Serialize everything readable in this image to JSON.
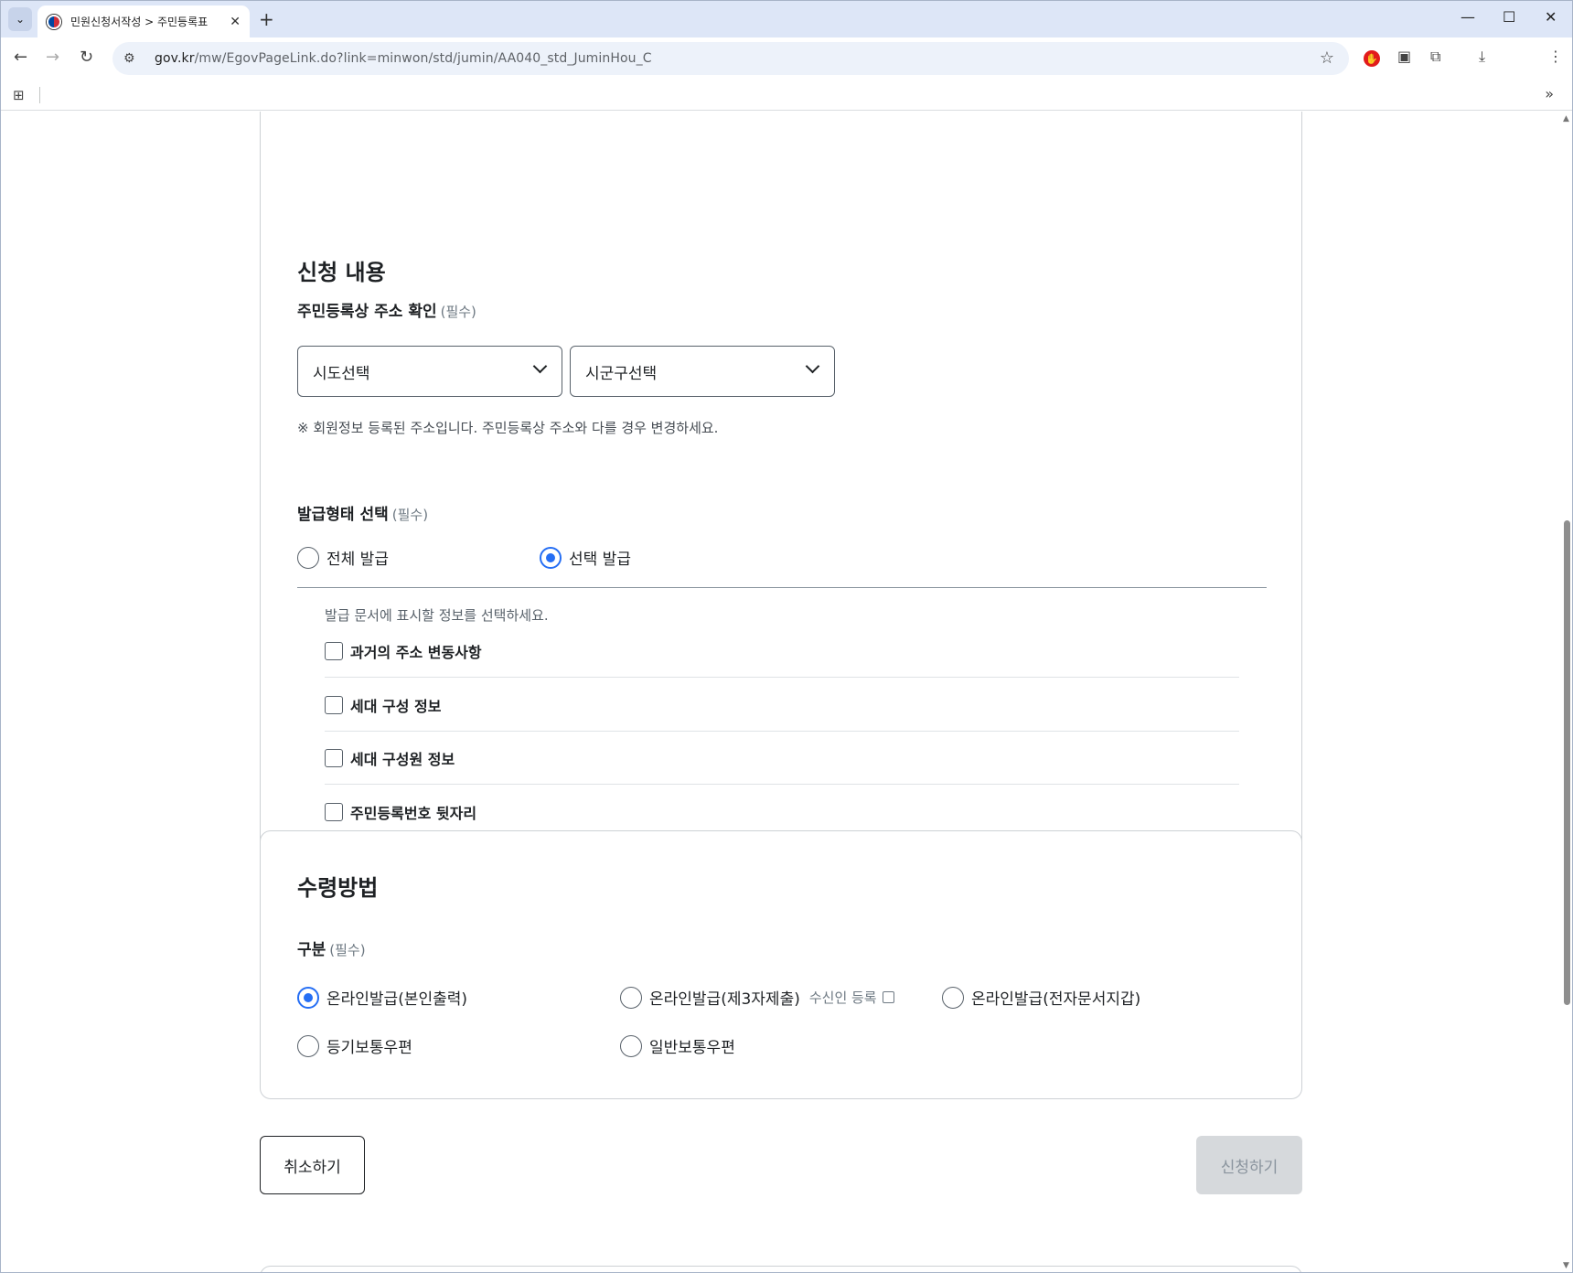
{
  "browser": {
    "tab_title": "민원신청서작성 > 주민등록표",
    "url_host": "gov.kr",
    "url_path": "/mw/EgovPageLink.do?link=minwon/std/jumin/AA040_std_JuminHou_C"
  },
  "application": {
    "section_title": "신청 내용",
    "address": {
      "label": "주민등록상 주소 확인",
      "required": "(필수)",
      "sido_select": "시도선택",
      "sigungu_select": "시군구선택",
      "note": "※ 회원정보 등록된 주소입니다. 주민등록상 주소와 다를 경우 변경하세요."
    },
    "issue_type": {
      "label": "발급형태 선택",
      "required": "(필수)",
      "options": [
        "전체 발급",
        "선택 발급"
      ],
      "selected": "선택 발급",
      "hint": "발급 문서에 표시할 정보를 선택하세요.",
      "checkboxes": [
        "과거의 주소 변동사항",
        "세대 구성 정보",
        "세대 구성원 정보",
        "주민등록번호 뒷자리"
      ]
    }
  },
  "receipt": {
    "section_title": "수령방법",
    "type_label": "구분",
    "required": "(필수)",
    "options": [
      "온라인발급(본인출력)",
      "온라인발급(제3자제출)",
      "온라인발급(전자문서지갑)",
      "등기보통우편",
      "일반보통우편"
    ],
    "selected": "온라인발급(본인출력)",
    "recipient_link": "수신인 등록"
  },
  "actions": {
    "cancel": "취소하기",
    "submit": "신청하기"
  },
  "colors": {
    "accent": "#256ef4",
    "disabled_button": "#d6d9dc"
  }
}
